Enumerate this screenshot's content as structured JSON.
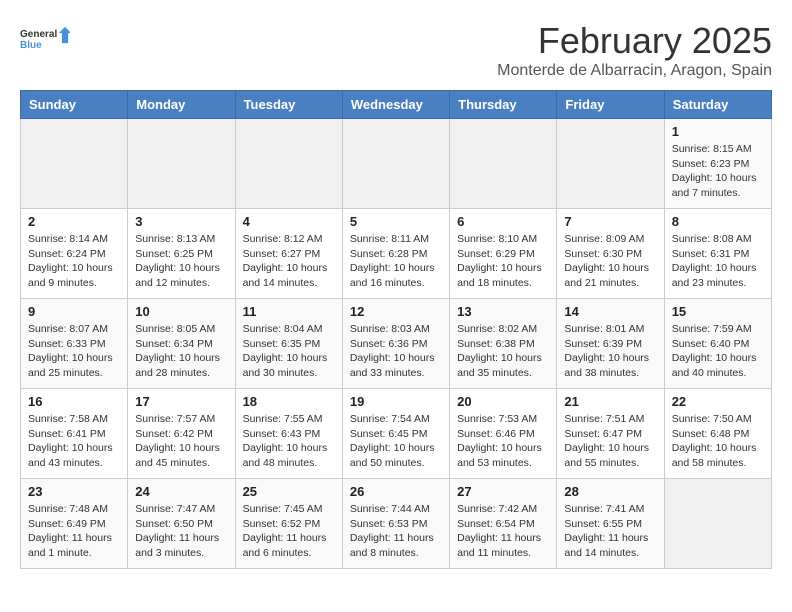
{
  "header": {
    "logo_general": "General",
    "logo_blue": "Blue",
    "title": "February 2025",
    "subtitle": "Monterde de Albarracin, Aragon, Spain"
  },
  "days_of_week": [
    "Sunday",
    "Monday",
    "Tuesday",
    "Wednesday",
    "Thursday",
    "Friday",
    "Saturday"
  ],
  "weeks": [
    [
      {
        "day": "",
        "info": ""
      },
      {
        "day": "",
        "info": ""
      },
      {
        "day": "",
        "info": ""
      },
      {
        "day": "",
        "info": ""
      },
      {
        "day": "",
        "info": ""
      },
      {
        "day": "",
        "info": ""
      },
      {
        "day": "1",
        "info": "Sunrise: 8:15 AM\nSunset: 6:23 PM\nDaylight: 10 hours and 7 minutes."
      }
    ],
    [
      {
        "day": "2",
        "info": "Sunrise: 8:14 AM\nSunset: 6:24 PM\nDaylight: 10 hours and 9 minutes."
      },
      {
        "day": "3",
        "info": "Sunrise: 8:13 AM\nSunset: 6:25 PM\nDaylight: 10 hours and 12 minutes."
      },
      {
        "day": "4",
        "info": "Sunrise: 8:12 AM\nSunset: 6:27 PM\nDaylight: 10 hours and 14 minutes."
      },
      {
        "day": "5",
        "info": "Sunrise: 8:11 AM\nSunset: 6:28 PM\nDaylight: 10 hours and 16 minutes."
      },
      {
        "day": "6",
        "info": "Sunrise: 8:10 AM\nSunset: 6:29 PM\nDaylight: 10 hours and 18 minutes."
      },
      {
        "day": "7",
        "info": "Sunrise: 8:09 AM\nSunset: 6:30 PM\nDaylight: 10 hours and 21 minutes."
      },
      {
        "day": "8",
        "info": "Sunrise: 8:08 AM\nSunset: 6:31 PM\nDaylight: 10 hours and 23 minutes."
      }
    ],
    [
      {
        "day": "9",
        "info": "Sunrise: 8:07 AM\nSunset: 6:33 PM\nDaylight: 10 hours and 25 minutes."
      },
      {
        "day": "10",
        "info": "Sunrise: 8:05 AM\nSunset: 6:34 PM\nDaylight: 10 hours and 28 minutes."
      },
      {
        "day": "11",
        "info": "Sunrise: 8:04 AM\nSunset: 6:35 PM\nDaylight: 10 hours and 30 minutes."
      },
      {
        "day": "12",
        "info": "Sunrise: 8:03 AM\nSunset: 6:36 PM\nDaylight: 10 hours and 33 minutes."
      },
      {
        "day": "13",
        "info": "Sunrise: 8:02 AM\nSunset: 6:38 PM\nDaylight: 10 hours and 35 minutes."
      },
      {
        "day": "14",
        "info": "Sunrise: 8:01 AM\nSunset: 6:39 PM\nDaylight: 10 hours and 38 minutes."
      },
      {
        "day": "15",
        "info": "Sunrise: 7:59 AM\nSunset: 6:40 PM\nDaylight: 10 hours and 40 minutes."
      }
    ],
    [
      {
        "day": "16",
        "info": "Sunrise: 7:58 AM\nSunset: 6:41 PM\nDaylight: 10 hours and 43 minutes."
      },
      {
        "day": "17",
        "info": "Sunrise: 7:57 AM\nSunset: 6:42 PM\nDaylight: 10 hours and 45 minutes."
      },
      {
        "day": "18",
        "info": "Sunrise: 7:55 AM\nSunset: 6:43 PM\nDaylight: 10 hours and 48 minutes."
      },
      {
        "day": "19",
        "info": "Sunrise: 7:54 AM\nSunset: 6:45 PM\nDaylight: 10 hours and 50 minutes."
      },
      {
        "day": "20",
        "info": "Sunrise: 7:53 AM\nSunset: 6:46 PM\nDaylight: 10 hours and 53 minutes."
      },
      {
        "day": "21",
        "info": "Sunrise: 7:51 AM\nSunset: 6:47 PM\nDaylight: 10 hours and 55 minutes."
      },
      {
        "day": "22",
        "info": "Sunrise: 7:50 AM\nSunset: 6:48 PM\nDaylight: 10 hours and 58 minutes."
      }
    ],
    [
      {
        "day": "23",
        "info": "Sunrise: 7:48 AM\nSunset: 6:49 PM\nDaylight: 11 hours and 1 minute."
      },
      {
        "day": "24",
        "info": "Sunrise: 7:47 AM\nSunset: 6:50 PM\nDaylight: 11 hours and 3 minutes."
      },
      {
        "day": "25",
        "info": "Sunrise: 7:45 AM\nSunset: 6:52 PM\nDaylight: 11 hours and 6 minutes."
      },
      {
        "day": "26",
        "info": "Sunrise: 7:44 AM\nSunset: 6:53 PM\nDaylight: 11 hours and 8 minutes."
      },
      {
        "day": "27",
        "info": "Sunrise: 7:42 AM\nSunset: 6:54 PM\nDaylight: 11 hours and 11 minutes."
      },
      {
        "day": "28",
        "info": "Sunrise: 7:41 AM\nSunset: 6:55 PM\nDaylight: 11 hours and 14 minutes."
      },
      {
        "day": "",
        "info": ""
      }
    ]
  ]
}
